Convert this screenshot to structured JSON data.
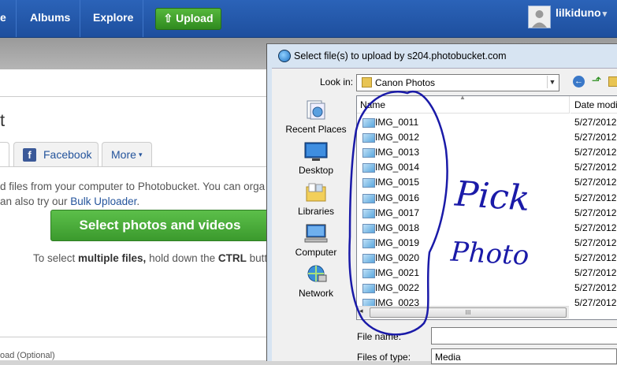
{
  "nav": {
    "item_frag": "e",
    "albums": "Albums",
    "explore": "Explore",
    "upload": "Upload",
    "upload_icon": "up-arrow-icon",
    "user": "lilkiduno",
    "user_caret": "▾"
  },
  "page": {
    "title_frag": "t",
    "tabs": {
      "facebook": "Facebook",
      "more": "More",
      "more_caret": "▾"
    },
    "line1": "d files from your computer to Photobucket. You can orga",
    "line2_pre": "an also try our ",
    "bulk_uploader": "Bulk Uploader",
    "line2_post": ".",
    "select_button": "Select photos and videos",
    "hint_pre": "To select ",
    "hint_bold": "multiple files,",
    "hint_mid": " hold down the ",
    "hint_ctrl": "CTRL",
    "hint_post": " butt",
    "bottom_frag": "oad (Optional)"
  },
  "dialog": {
    "title": "Select file(s) to upload by s204.photobucket.com",
    "look_in_label": "Look in:",
    "look_in_value": "Canon Photos",
    "places": [
      "Recent Places",
      "Desktop",
      "Libraries",
      "Computer",
      "Network"
    ],
    "columns": {
      "name": "Name",
      "date": "Date modi"
    },
    "files": [
      {
        "name": "IMG_0011",
        "date": "5/27/2012"
      },
      {
        "name": "IMG_0012",
        "date": "5/27/2012"
      },
      {
        "name": "IMG_0013",
        "date": "5/27/2012"
      },
      {
        "name": "IMG_0014",
        "date": "5/27/2012"
      },
      {
        "name": "IMG_0015",
        "date": "5/27/2012"
      },
      {
        "name": "IMG_0016",
        "date": "5/27/2012"
      },
      {
        "name": "IMG_0017",
        "date": "5/27/2012"
      },
      {
        "name": "IMG_0018",
        "date": "5/27/2012"
      },
      {
        "name": "IMG_0019",
        "date": "5/27/2012"
      },
      {
        "name": "IMG_0020",
        "date": "5/27/2012"
      },
      {
        "name": "IMG_0021",
        "date": "5/27/2012"
      },
      {
        "name": "IMG_0022",
        "date": "5/27/2012"
      },
      {
        "name": "IMG_0023",
        "date": "5/27/2012"
      }
    ],
    "file_name_label": "File name:",
    "file_name_value": "",
    "files_of_type_label": "Files of type:",
    "files_of_type_value": "Media"
  },
  "annotation": {
    "line1": "Pick",
    "line2": "Photo",
    "ink_color": "#1a1aa8"
  },
  "colors": {
    "nav_blue": "#1e4f9e",
    "upload_green": "#3b9a2d",
    "link_blue": "#24549c"
  }
}
